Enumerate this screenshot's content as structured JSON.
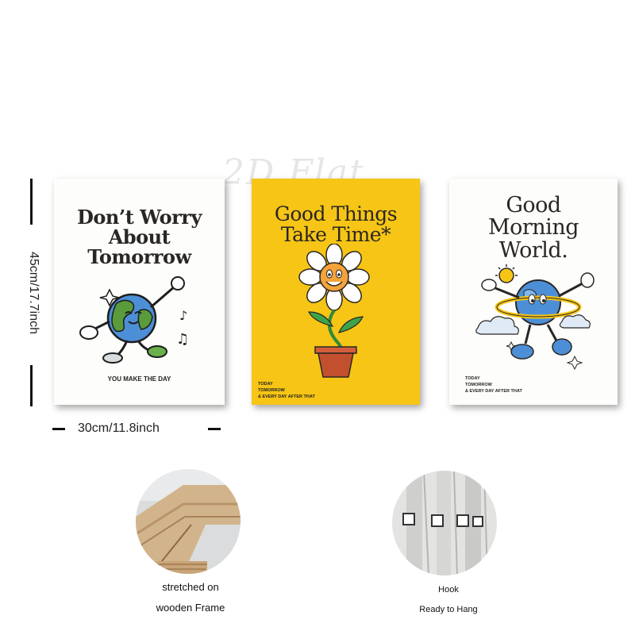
{
  "watermark": "2D Flat",
  "posters": [
    {
      "title_lines": [
        "Don’t Worry",
        "About",
        "Tomorrow"
      ],
      "tagline": "YOU MAKE THE DAY",
      "bg": "#fdfdfb"
    },
    {
      "title_lines": [
        "Good Things",
        "Take Time*"
      ],
      "small_lines": [
        "TODAY",
        "TOMORROW",
        "& EVERY DAY AFTER THAT"
      ],
      "bg": "#f6c515"
    },
    {
      "title_lines": [
        "Good",
        "Morning",
        "World."
      ],
      "small_lines": [
        "TODAY",
        "TOMORROW",
        "& EVERY DAY AFTER THAT"
      ],
      "bg": "#fdfdfb"
    }
  ],
  "dimensions": {
    "height_label": "45cm/17.7inch",
    "width_label": "30cm/11.8inch"
  },
  "features": [
    {
      "caption_lines": [
        "stretched on",
        "wooden Frame"
      ],
      "icon": "wooden-frame-photo"
    },
    {
      "caption_lines": [
        "Hook",
        "Ready to Hang"
      ],
      "icon": "hook-photo"
    }
  ],
  "colors": {
    "yellow": "#f6c515",
    "ink": "#2a2623",
    "blue": "#4d8fd6"
  }
}
